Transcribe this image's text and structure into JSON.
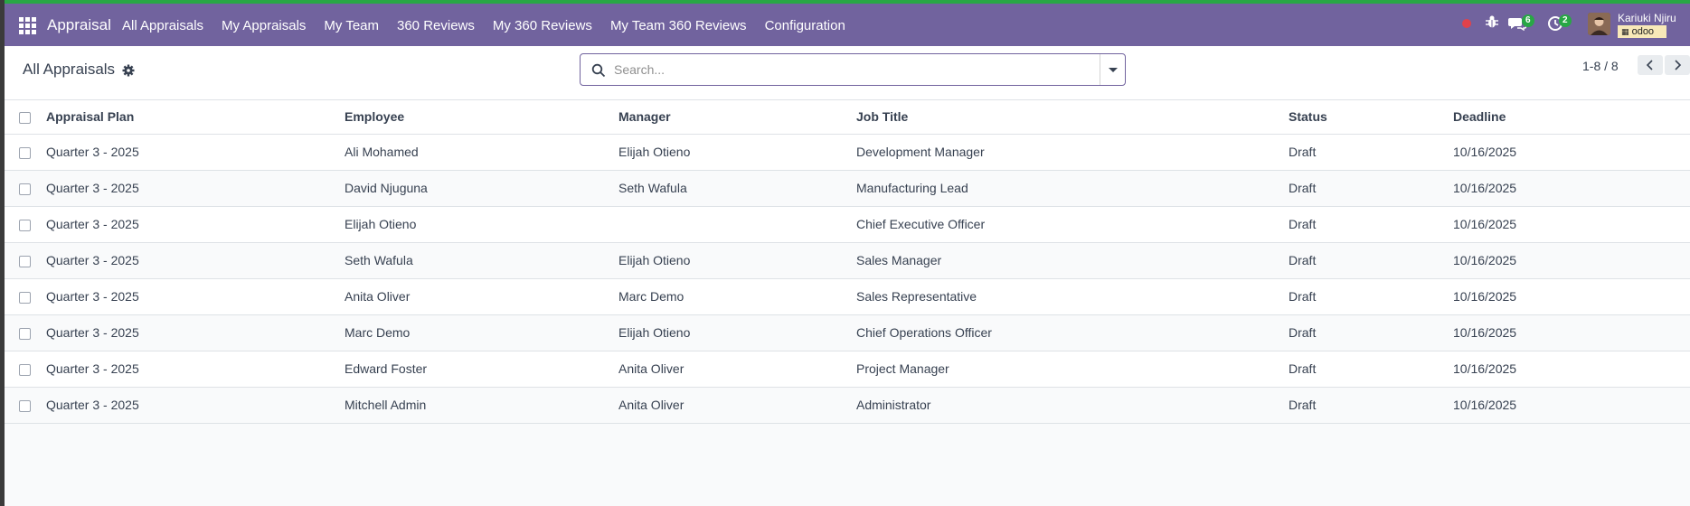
{
  "app": {
    "brand": "Appraisal",
    "menu": [
      "All Appraisals",
      "My Appraisals",
      "My Team",
      "360 Reviews",
      "My 360 Reviews",
      "My Team 360 Reviews",
      "Configuration"
    ],
    "chat_count": "6",
    "activity_count": "2",
    "user_name": "Kariuki Njiru",
    "database": "odoo",
    "accent_color": "#71639e",
    "icons": [
      "apps-icon",
      "record-dot-icon",
      "bug-icon",
      "chat-icon",
      "activity-clock-icon",
      "avatar",
      "gear-icon",
      "search-icon",
      "chevron-down-icon",
      "chevron-left-icon",
      "chevron-right-icon"
    ]
  },
  "control": {
    "title": "All Appraisals",
    "search_placeholder": "Search...",
    "pager": "1-8 / 8"
  },
  "table": {
    "columns": [
      "Appraisal Plan",
      "Employee",
      "Manager",
      "Job Title",
      "Status",
      "Deadline"
    ],
    "rows": [
      [
        "Quarter 3 - 2025",
        "Ali Mohamed",
        "Elijah Otieno",
        "Development Manager",
        "Draft",
        "10/16/2025"
      ],
      [
        "Quarter 3 - 2025",
        "David Njuguna",
        "Seth Wafula",
        "Manufacturing Lead",
        "Draft",
        "10/16/2025"
      ],
      [
        "Quarter 3 - 2025",
        "Elijah Otieno",
        "",
        "Chief Executive Officer",
        "Draft",
        "10/16/2025"
      ],
      [
        "Quarter 3 - 2025",
        "Seth Wafula",
        "Elijah Otieno",
        "Sales Manager",
        "Draft",
        "10/16/2025"
      ],
      [
        "Quarter 3 - 2025",
        "Anita Oliver",
        "Marc Demo",
        "Sales Representative",
        "Draft",
        "10/16/2025"
      ],
      [
        "Quarter 3 - 2025",
        "Marc Demo",
        "Elijah Otieno",
        "Chief Operations Officer",
        "Draft",
        "10/16/2025"
      ],
      [
        "Quarter 3 - 2025",
        "Edward Foster",
        "Anita Oliver",
        "Project Manager",
        "Draft",
        "10/16/2025"
      ],
      [
        "Quarter 3 - 2025",
        "Mitchell Admin",
        "Anita Oliver",
        "Administrator",
        "Draft",
        "10/16/2025"
      ]
    ]
  }
}
